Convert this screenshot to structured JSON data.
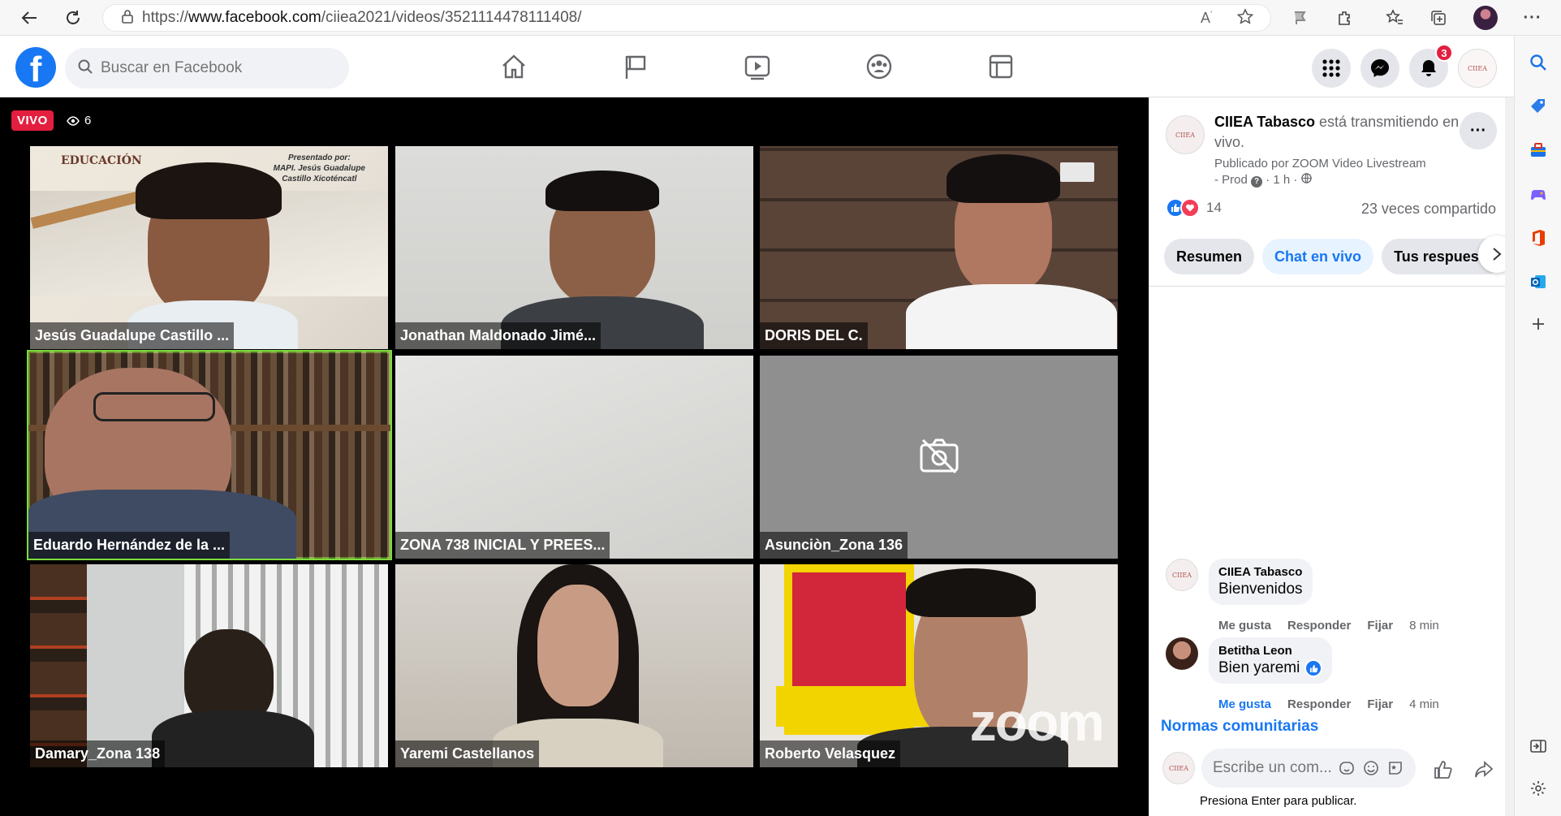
{
  "browser": {
    "url_prefix": "https://",
    "url_domain": "www.facebook.com",
    "url_path": "/ciiea2021/videos/3521114478111408/"
  },
  "facebook": {
    "logo": "f",
    "search_placeholder": "Buscar en Facebook",
    "notification_count": "3",
    "brand_color": "#1877f2"
  },
  "video": {
    "live_label": "VIVO",
    "viewer_count": "6",
    "participants": [
      {
        "name": "Jesús Guadalupe Castillo ..."
      },
      {
        "name": "Jonathan Maldonado Jimé..."
      },
      {
        "name": "DORIS DEL C."
      },
      {
        "name": "Eduardo Hernández de la ..."
      },
      {
        "name": "ZONA 738 INICIAL Y PREES..."
      },
      {
        "name": "Asunciòn_Zona 136"
      },
      {
        "name": "Damary_Zona 138"
      },
      {
        "name": "Yaremi Castellanos"
      },
      {
        "name": "Roberto Velasquez"
      }
    ],
    "tile1_text": {
      "banner": "EDUCACIÓN",
      "presenter_line1": "Presentado por:",
      "presenter_line2": "MAPI. Jesús Guadalupe",
      "presenter_line3": "Castillo Xicoténcatl"
    },
    "watermark": "zoom",
    "active_speaker_color": "#7ddc3c"
  },
  "panel": {
    "host_name": "CIIEA Tabasco",
    "host_status": "está transmitiendo en vivo.",
    "published_by": "Publicado por ZOOM Video Livestream",
    "published_meta": "- Prod",
    "published_time": "· 1 h ·",
    "reaction_count": "14",
    "shares": "23 veces compartido",
    "tabs": [
      {
        "label": "Resumen"
      },
      {
        "label": "Chat en vivo"
      },
      {
        "label": "Tus respuesta"
      }
    ],
    "comments": [
      {
        "author": "CIIEA Tabasco",
        "text": "Bienvenidos",
        "like": "Me gusta",
        "reply": "Responder",
        "pin": "Fijar",
        "time": "8 min"
      },
      {
        "author": "Betitha Leon",
        "text": "Bien yaremi",
        "like": "Me gusta",
        "reply": "Responder",
        "pin": "Fijar",
        "time": "4 min"
      }
    ],
    "community_norms": "Normas comunitarias",
    "write_placeholder": "Escribe un com...",
    "enter_hint": "Presiona Enter para publicar.",
    "avatar_text": "CIIEA"
  }
}
